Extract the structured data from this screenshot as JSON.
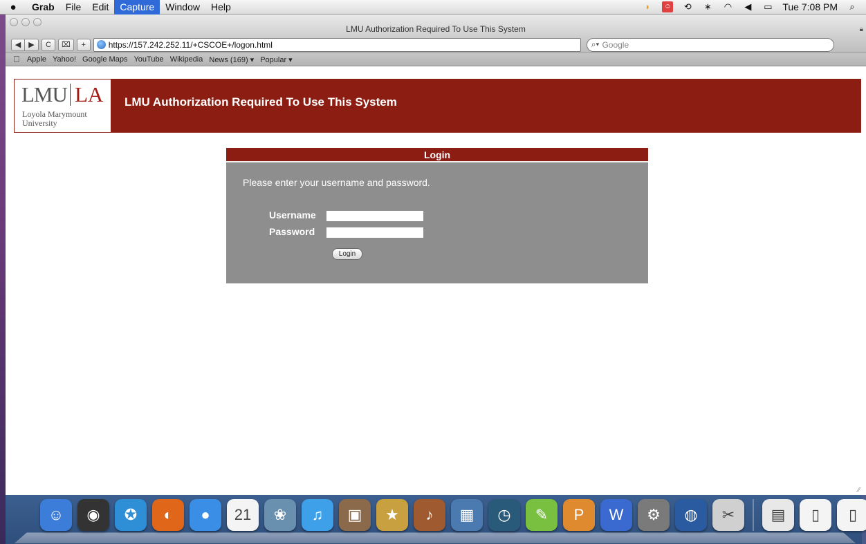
{
  "menubar": {
    "apple_icon": "apple-icon",
    "items": [
      {
        "label": "Grab",
        "bold": true
      },
      {
        "label": "File"
      },
      {
        "label": "Edit"
      },
      {
        "label": "Capture",
        "active": true
      },
      {
        "label": "Window"
      },
      {
        "label": "Help"
      }
    ],
    "clock": "Tue 7:08 PM",
    "status_icons": [
      "moon-icon",
      "calendar-alert-icon",
      "time-machine-icon",
      "bluetooth-icon",
      "wifi-icon",
      "volume-icon",
      "battery-icon",
      "spotlight-icon"
    ]
  },
  "window": {
    "title": "LMU Authorization Required To Use This System",
    "url": "https://157.242.252.11/+CSCOE+/logon.html",
    "search_placeholder": "Google",
    "toolbar": {
      "reload_label": "C",
      "add_label": "+"
    },
    "bookmarks": [
      "Apple",
      "Yahoo!",
      "Google Maps",
      "YouTube",
      "Wikipedia",
      "News (169) ▾",
      "Popular ▾"
    ]
  },
  "page": {
    "logo": {
      "lmu": "LMU",
      "la": "LA",
      "line1": "Loyola Marymount",
      "line2": "University"
    },
    "header_title": "LMU Authorization Required To Use This System",
    "login": {
      "heading": "Login",
      "message": "Please enter your username and password.",
      "username_label": "Username",
      "password_label": "Password",
      "username_value": "",
      "password_value": "",
      "button_label": "Login"
    }
  },
  "colors": {
    "lmu_crimson": "#8b1d12",
    "panel_gray": "#8e8e8e",
    "menu_active": "#2f6ad8"
  },
  "dock": {
    "icons": [
      {
        "name": "finder-icon",
        "color": "#3b7dd8",
        "glyph": "☺"
      },
      {
        "name": "dashboard-icon",
        "color": "#333333",
        "glyph": "◉"
      },
      {
        "name": "safari-icon",
        "color": "#2e8fd6",
        "glyph": "✪"
      },
      {
        "name": "firefox-icon",
        "color": "#e0661a",
        "glyph": "◐"
      },
      {
        "name": "ichat-icon",
        "color": "#3a8ee6",
        "glyph": "●"
      },
      {
        "name": "ical-icon",
        "color": "#f4f4f4",
        "glyph": "21"
      },
      {
        "name": "iphoto-icon",
        "color": "#6a90b0",
        "glyph": "❀"
      },
      {
        "name": "itunes-icon",
        "color": "#3ea0e8",
        "glyph": "♫"
      },
      {
        "name": "image-capture-icon",
        "color": "#8a6a4a",
        "glyph": "▣"
      },
      {
        "name": "imovie-icon",
        "color": "#c8a040",
        "glyph": "★"
      },
      {
        "name": "garageband-icon",
        "color": "#a05a30",
        "glyph": "♪"
      },
      {
        "name": "spaces-icon",
        "color": "#4a7ab0",
        "glyph": "▦"
      },
      {
        "name": "time-machine-dock-icon",
        "color": "#2a5a7a",
        "glyph": "◷"
      },
      {
        "name": "sketch-icon",
        "color": "#7ac040",
        "glyph": "✎"
      },
      {
        "name": "pages-icon",
        "color": "#e08a30",
        "glyph": "P"
      },
      {
        "name": "lw-icon",
        "color": "#3a6ad0",
        "glyph": "W"
      },
      {
        "name": "system-preferences-icon",
        "color": "#7a7a7a",
        "glyph": "⚙"
      },
      {
        "name": "google-earth-icon",
        "color": "#2a5aa0",
        "glyph": "◍"
      },
      {
        "name": "script-editor-icon",
        "color": "#d0d0d0",
        "glyph": "✂"
      }
    ],
    "right_icons": [
      {
        "name": "docx-file-icon",
        "color": "#e8e8e8",
        "glyph": "▤"
      },
      {
        "name": "document-icon",
        "color": "#f4f4f4",
        "glyph": "▯"
      },
      {
        "name": "document-2-icon",
        "color": "#f4f4f4",
        "glyph": "▯"
      },
      {
        "name": "trash-icon",
        "color": "#9aa0a6",
        "glyph": "⌫"
      }
    ]
  }
}
